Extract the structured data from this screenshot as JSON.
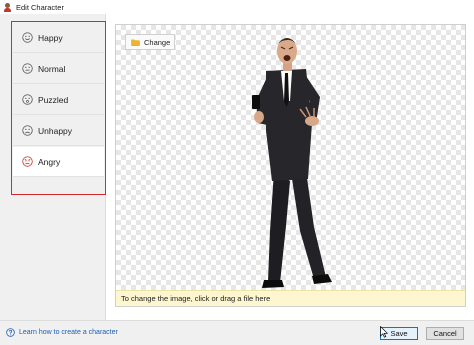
{
  "window": {
    "title": "Edit Character"
  },
  "sidebar": {
    "items": [
      {
        "label": "Happy",
        "icon": "happy-face-icon"
      },
      {
        "label": "Normal",
        "icon": "neutral-face-icon"
      },
      {
        "label": "Puzzled",
        "icon": "puzzled-face-icon"
      },
      {
        "label": "Unhappy",
        "icon": "unhappy-face-icon"
      },
      {
        "label": "Angry",
        "icon": "angry-face-icon",
        "selected": true
      }
    ]
  },
  "canvas": {
    "change_label": "Change",
    "hint": "To change the image, click or drag a file here"
  },
  "footer": {
    "help_link": "Learn how to create a character",
    "save_label": "Save",
    "cancel_label": "Cancel"
  },
  "colors": {
    "highlight_border": "#d9262c",
    "angry_accent": "#c0392b",
    "hint_bg": "#fdf6cf",
    "link": "#1a5fb4"
  }
}
